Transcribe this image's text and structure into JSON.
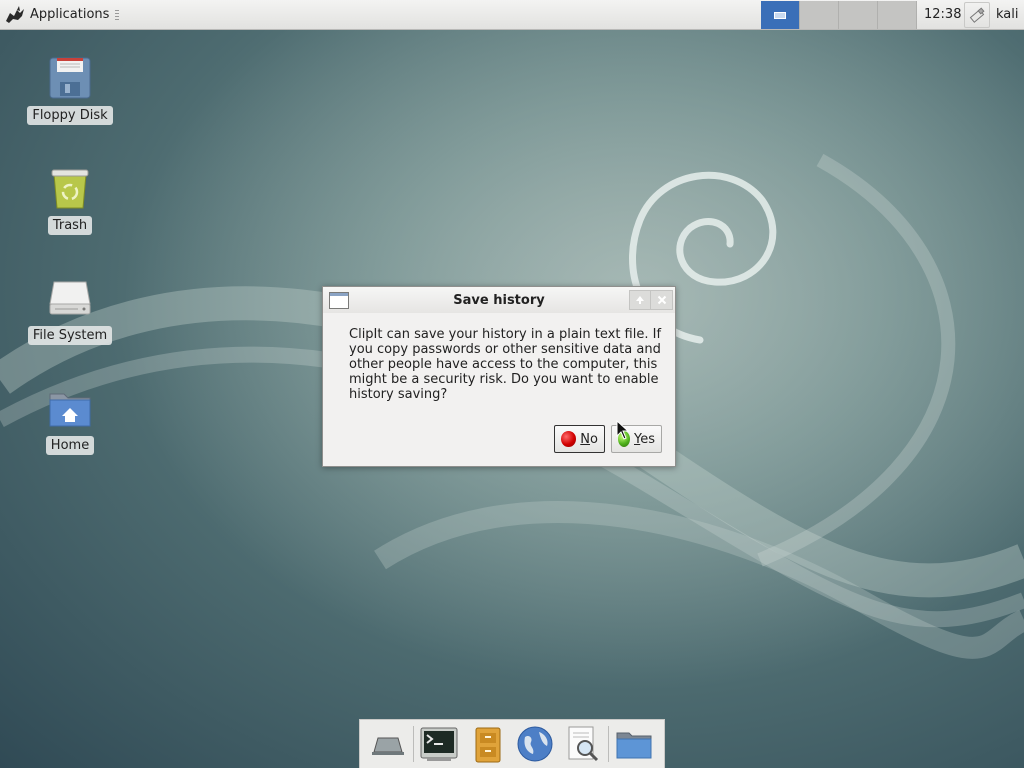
{
  "top_panel": {
    "applications_label": "Applications",
    "clock": "12:38",
    "user": "kali",
    "workspaces": [
      "1",
      "2",
      "3",
      "4"
    ],
    "active_workspace_index": 0
  },
  "desktop": {
    "icons": [
      {
        "label": "Floppy Disk",
        "icon": "floppy-disk-icon"
      },
      {
        "label": "Trash",
        "icon": "trash-icon"
      },
      {
        "label": "File System",
        "icon": "drive-icon"
      },
      {
        "label": "Home",
        "icon": "home-folder-icon"
      }
    ]
  },
  "dialog": {
    "title": "Save history",
    "message": "ClipIt can save your history in a plain text file. If you copy passwords or other sensitive data and other people have access to the computer, this might be a security risk. Do you want to enable history saving?",
    "no_mnemonic": "N",
    "no_rest": "o",
    "yes_mnemonic": "Y",
    "yes_rest": "es"
  },
  "dock": {
    "items": [
      {
        "name": "show-desktop-icon"
      },
      {
        "name": "terminal-icon"
      },
      {
        "name": "file-manager-cabinet-icon"
      },
      {
        "name": "web-browser-icon"
      },
      {
        "name": "app-finder-icon"
      },
      {
        "name": "folder-icon"
      }
    ]
  },
  "colors": {
    "workspace_active": "#3a6fb8",
    "no_button_icon": "#d10000",
    "yes_button_icon": "#4fb21c"
  }
}
